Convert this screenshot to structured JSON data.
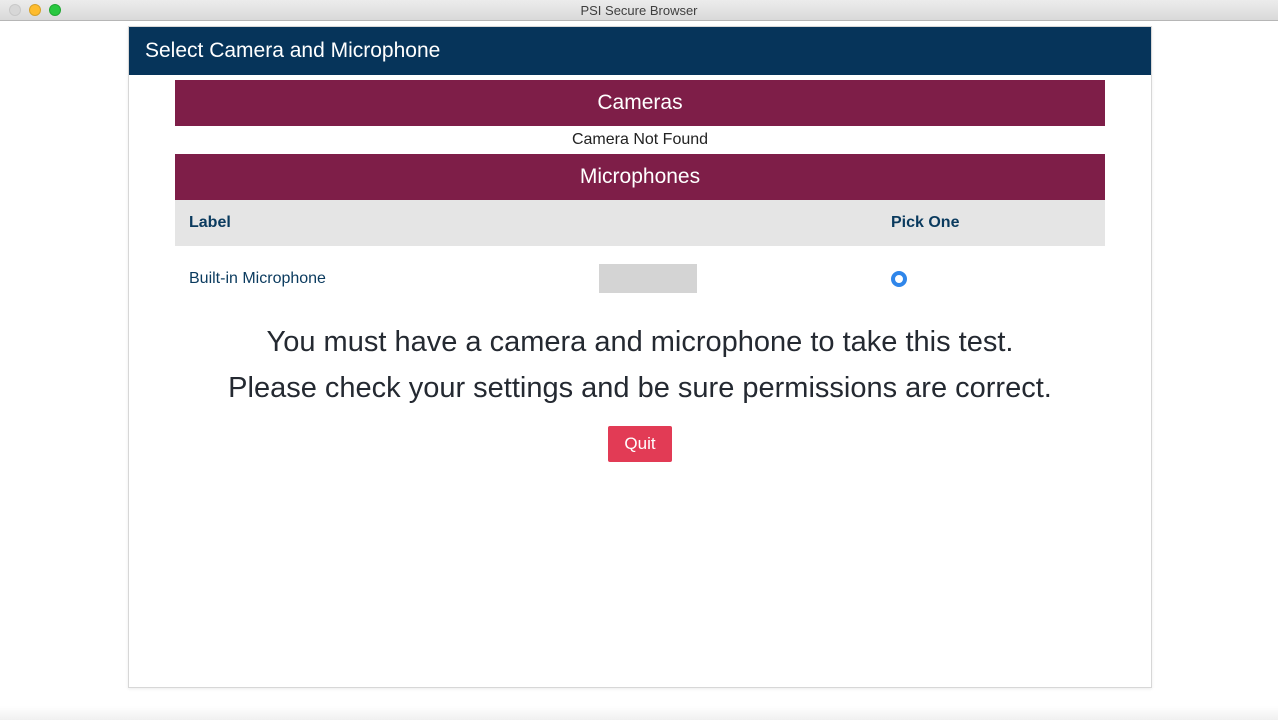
{
  "window": {
    "title": "PSI Secure Browser"
  },
  "header": {
    "title": "Select Camera and Microphone"
  },
  "cameras": {
    "banner": "Cameras",
    "status": "Camera Not Found"
  },
  "microphones": {
    "banner": "Microphones",
    "columns": {
      "label": "Label",
      "pick": "Pick One"
    },
    "rows": [
      {
        "label": "Built-in Microphone",
        "selected": true
      }
    ]
  },
  "messages": {
    "line1": "You must have a camera and microphone to take this test.",
    "line2": "Please check your settings and be sure permissions are correct."
  },
  "actions": {
    "quit": "Quit"
  }
}
